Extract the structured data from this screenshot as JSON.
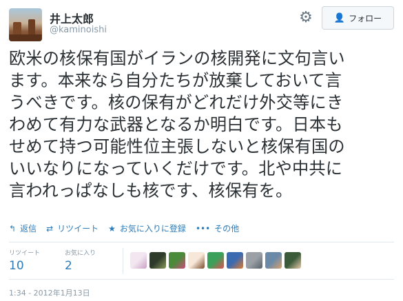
{
  "user": {
    "name": "井上太郎",
    "handle": "@kaminoishi"
  },
  "header": {
    "follow_label": "フォロー",
    "gear_icon": "gear-icon",
    "follow_icon": "person-plus-icon"
  },
  "tweet": {
    "lines": [
      "欧米の核保有国がイランの核開発に文句言い",
      "ます。本来なら自分たちが放棄しておいて言",
      "うべきです。核の保有がどれだけ外交等にき",
      "わめて有力な武器となるか明白です。日本も",
      "せめて持つ可能性位主張しないと核保有国の",
      "いいなりになっていくだけです。北や中共に",
      "言われっぱなしも核です、核保有を。"
    ]
  },
  "actions": [
    {
      "icon": "reply-icon",
      "glyph": "↰",
      "label": "返信"
    },
    {
      "icon": "retweet-icon",
      "glyph": "⇄",
      "label": "リツイート"
    },
    {
      "icon": "star-icon",
      "glyph": "★",
      "label": "お気に入りに登録"
    },
    {
      "icon": "more-icon",
      "glyph": "•••",
      "label": "その他"
    }
  ],
  "stats": {
    "retweets_label": "リツイート",
    "retweets_value": "10",
    "favorites_label": "お気に入り",
    "favorites_value": "2"
  },
  "favoriter_avatars": [
    {
      "name": "favoriter-avatar-1",
      "colors": [
        "#f3e6f0",
        "#c9a0c4"
      ]
    },
    {
      "name": "favoriter-avatar-2",
      "colors": [
        "#2f3b2a",
        "#8a9a5b"
      ]
    },
    {
      "name": "favoriter-avatar-3",
      "colors": [
        "#4a8a3a",
        "#d04a7a"
      ]
    },
    {
      "name": "favoriter-avatar-4",
      "colors": [
        "#f7e7d8",
        "#7a4a2a"
      ]
    },
    {
      "name": "favoriter-avatar-5",
      "colors": [
        "#3aa05a",
        "#e05050"
      ]
    },
    {
      "name": "favoriter-avatar-6",
      "colors": [
        "#3a6ab0",
        "#e07a30"
      ]
    },
    {
      "name": "favoriter-avatar-7",
      "colors": [
        "#9aa0a6",
        "#5a6068"
      ]
    },
    {
      "name": "favoriter-avatar-8",
      "colors": [
        "#6a8aa8",
        "#d8a070"
      ]
    },
    {
      "name": "favoriter-avatar-9",
      "colors": [
        "#3a5a3a",
        "#e8c8a8"
      ]
    }
  ],
  "timestamp": "1:34 - 2012年1月13日",
  "colors": {
    "link": "#2b7bb9",
    "muted": "#8899a6",
    "text": "#292f33",
    "divider": "#e1e8ed"
  }
}
